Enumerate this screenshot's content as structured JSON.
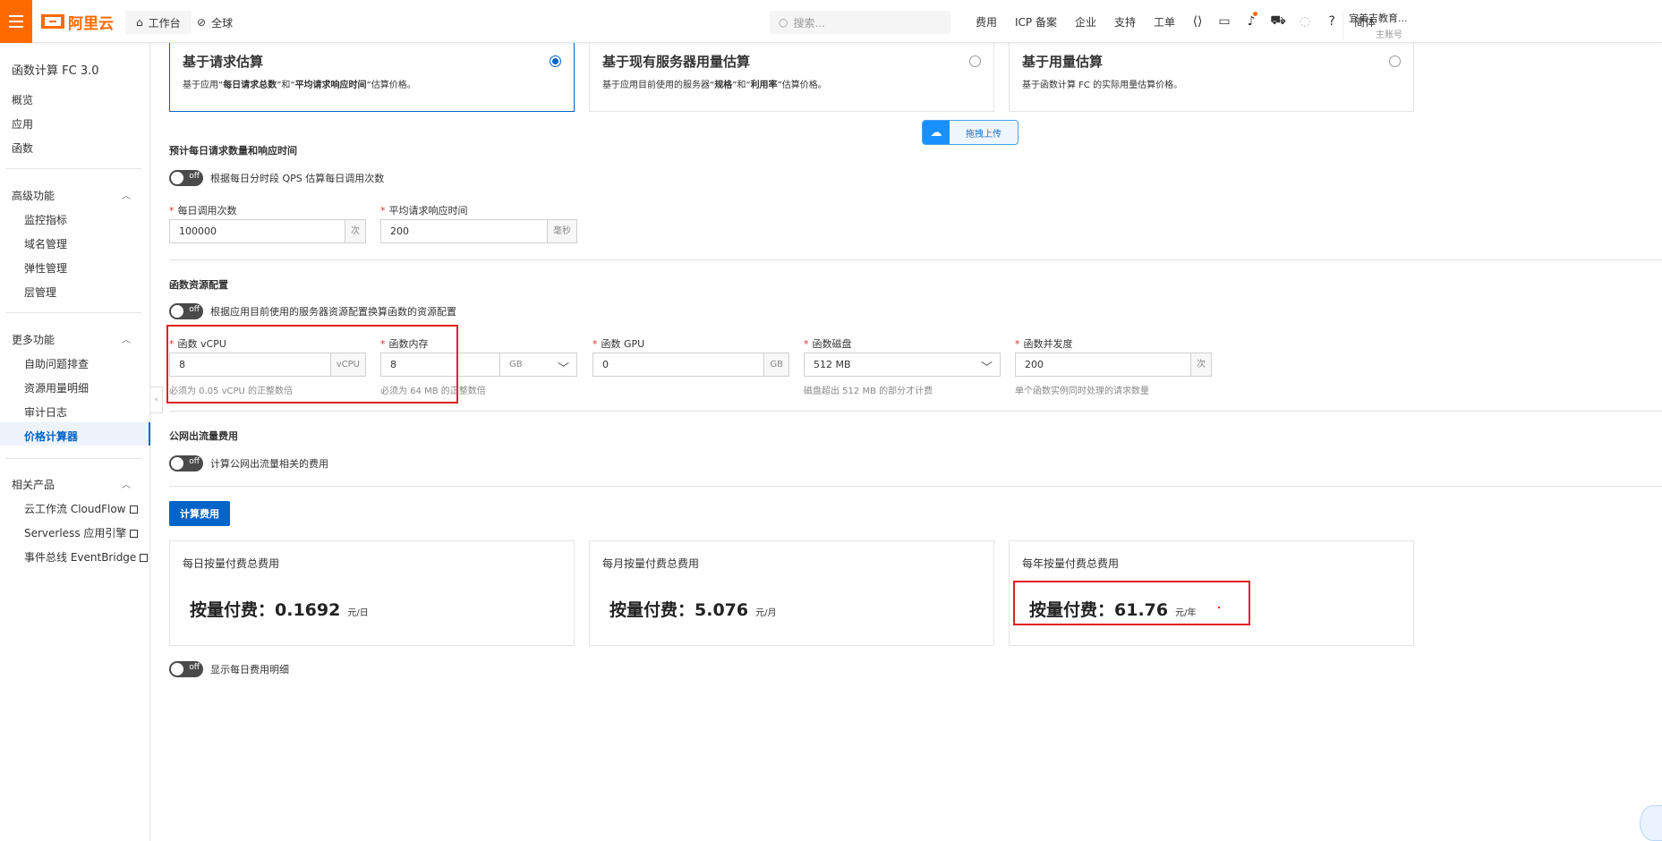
{
  "header": {
    "logo_text": "阿里云",
    "workspace": "工作台",
    "region": "全球",
    "search_placeholder": "搜索...",
    "links": [
      "费用",
      "ICP 备案",
      "企业",
      "支持",
      "工单"
    ],
    "lang": "简体",
    "account_name": "宜美吉教育...",
    "account_sub": "主账号"
  },
  "sidebar": {
    "title": "函数计算 FC 3.0",
    "top_items": [
      "概览",
      "应用",
      "函数"
    ],
    "groups": [
      {
        "label": "高级功能",
        "items": [
          "监控指标",
          "域名管理",
          "弹性管理",
          "层管理"
        ]
      },
      {
        "label": "更多功能",
        "items": [
          "自助问题排查",
          "资源用量明细",
          "审计日志",
          "价格计算器"
        ]
      },
      {
        "label": "相关产品",
        "items": [
          "云工作流 CloudFlow",
          "Serverless 应用引擎",
          "事件总线 EventBridge"
        ]
      }
    ]
  },
  "modes": [
    {
      "title": "基于请求估算",
      "desc_prefix": "基于应用“",
      "desc_b1": "每日请求总数",
      "desc_mid": "”和“",
      "desc_b2": "平均请求响应时间",
      "desc_suffix": "”估算价格。",
      "selected": true
    },
    {
      "title": "基于现有服务器用量估算",
      "desc_prefix": "基于应用目前使用的服务器“",
      "desc_b1": "规格",
      "desc_mid": "”和“",
      "desc_b2": "利用率",
      "desc_suffix": "”估算价格。",
      "selected": false
    },
    {
      "title": "基于用量估算",
      "desc": "基于函数计算 FC 的实际用量估算价格。",
      "selected": false
    }
  ],
  "upload_label": "拖拽上传",
  "requests": {
    "title": "预计每日请求数量和响应时间",
    "toggle_state": "off",
    "toggle_label": "根据每日分时段 QPS 估算每日调用次数",
    "daily_calls_label": "每日调用次数",
    "daily_calls_value": "100000",
    "daily_calls_unit": "次",
    "resp_time_label": "平均请求响应时间",
    "resp_time_value": "200",
    "resp_time_unit": "毫秒"
  },
  "resources": {
    "title": "函数资源配置",
    "toggle_state": "off",
    "toggle_label": "根据应用目前使用的服务器资源配置换算函数的资源配置",
    "vcpu_label": "函数 vCPU",
    "vcpu_value": "8",
    "vcpu_unit": "vCPU",
    "vcpu_hint": "必须为 0.05 vCPU 的正整数倍",
    "mem_label": "函数内存",
    "mem_value": "8",
    "mem_unit": "GB",
    "mem_hint": "必须为 64 MB 的正整数倍",
    "gpu_label": "函数 GPU",
    "gpu_value": "0",
    "gpu_unit": "GB",
    "disk_label": "函数磁盘",
    "disk_value": "512 MB",
    "disk_hint": "磁盘超出 512 MB 的部分才计费",
    "conc_label": "函数并发度",
    "conc_value": "200",
    "conc_unit": "次",
    "conc_hint": "单个函数实例同时处理的请求数量"
  },
  "traffic": {
    "title": "公网出流量费用",
    "toggle_state": "off",
    "toggle_label": "计算公网出流量相关的费用"
  },
  "calc_button": "计算费用",
  "results": [
    {
      "title": "每日按量付费总费用",
      "label": "按量付费：",
      "amount": "0.1692",
      "unit": "元/日"
    },
    {
      "title": "每月按量付费总费用",
      "label": "按量付费：",
      "amount": "5.076",
      "unit": "元/月"
    },
    {
      "title": "每年按量付费总费用",
      "label": "按量付费：",
      "amount": "61.76",
      "unit": "元/年"
    }
  ],
  "daily_detail": {
    "toggle_state": "off",
    "toggle_label": "显示每日费用明细"
  }
}
